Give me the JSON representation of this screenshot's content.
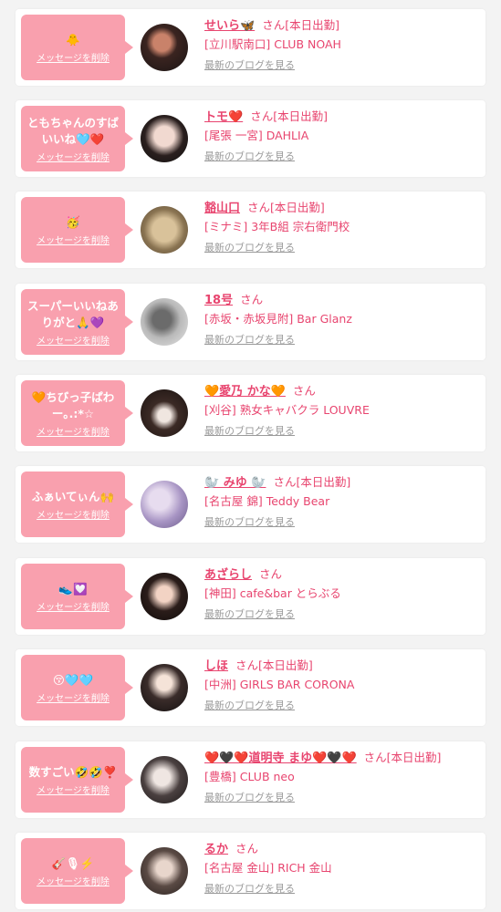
{
  "cards": [
    {
      "message": "🐥",
      "delete_label": "メッセージを削除",
      "name": "せいら🦋",
      "san": "さん",
      "status": "[本日出勤]",
      "shop": "[立川駅南口] CLUB NOAH",
      "blog_link": "最新のブログを見る"
    },
    {
      "message": "ともちゃんのすばいいね🩵❤️",
      "delete_label": "メッセージを削除",
      "name": "トモ❤️",
      "san": "さん",
      "status": "[本日出勤]",
      "shop": "[尾張 一宮] DAHLIA",
      "blog_link": "最新のブログを見る"
    },
    {
      "message": "🥳",
      "delete_label": "メッセージを削除",
      "name": "豁山口",
      "san": "さん",
      "status": "[本日出勤]",
      "shop": "[ミナミ] 3年B組 宗右衛門校",
      "blog_link": "最新のブログを見る"
    },
    {
      "message": "スーパーいいねありがと🙏💜",
      "delete_label": "メッセージを削除",
      "name": "18号",
      "san": "さん",
      "status": "",
      "shop": "[赤坂・赤坂見附] Bar Glanz",
      "blog_link": "最新のブログを見る"
    },
    {
      "message": "🧡ちびっ子ぱわー｡.:*☆",
      "delete_label": "メッセージを削除",
      "name": "🧡愛乃 かな🧡",
      "san": "さん",
      "status": "",
      "shop": "[刈谷] 熟女キャバクラ LOUVRE",
      "blog_link": "最新のブログを見る"
    },
    {
      "message": "ふぁいてぃん🙌",
      "delete_label": "メッセージを削除",
      "name": "🦭 みゆ 🦭",
      "san": "さん",
      "status": "[本日出勤]",
      "shop": "[名古屋 錦] Teddy Bear",
      "blog_link": "最新のブログを見る"
    },
    {
      "message": "👟💟",
      "delete_label": "メッセージを削除",
      "name": "あざらし",
      "san": "さん",
      "status": "",
      "shop": "[神田] cafe&bar とらぶる",
      "blog_link": "最新のブログを見る"
    },
    {
      "message": "😚🩵🩵",
      "delete_label": "メッセージを削除",
      "name": "しほ",
      "san": "さん",
      "status": "[本日出勤]",
      "shop": "[中洲] GIRLS BAR CORONA",
      "blog_link": "最新のブログを見る"
    },
    {
      "message": "数すごい🤣🤣❣️",
      "delete_label": "メッセージを削除",
      "name": "❤️🖤❤️道明寺 まゆ❤️🖤❤️",
      "san": "さん",
      "status": "[本日出勤]",
      "shop": "[豊橋] CLUB neo",
      "blog_link": "最新のブログを見る"
    },
    {
      "message": "🎸🎙⚡️",
      "delete_label": "メッセージを削除",
      "name": "るか",
      "san": "さん",
      "status": "",
      "shop": "[名古屋 金山] RICH 金山",
      "blog_link": "最新のブログを見る"
    }
  ],
  "colors": {
    "accent": "#e8456f",
    "bubble": "#f9a0ae",
    "muted": "#9a9a9a",
    "background": "#f3f3f3"
  },
  "icons": {
    "avatar": "profile-photo"
  }
}
